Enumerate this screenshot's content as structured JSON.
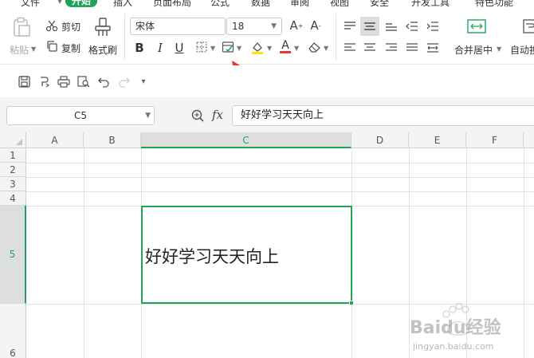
{
  "menu": {
    "items": [
      {
        "label": "文件",
        "x": 30
      },
      {
        "label": "开始",
        "active": true
      },
      {
        "label": "插入"
      },
      {
        "label": "页面布局"
      },
      {
        "label": "公式"
      },
      {
        "label": "数据"
      },
      {
        "label": "审阅"
      },
      {
        "label": "视图"
      },
      {
        "label": "安全"
      },
      {
        "label": "开发工具"
      },
      {
        "label": "特色功能"
      }
    ]
  },
  "ribbon": {
    "paste_label": "粘贴",
    "cut_label": "剪切",
    "copy_label": "复制",
    "format_painter_label": "格式刷",
    "font_name": "宋体",
    "font_size": "18",
    "bold": "B",
    "italic": "I",
    "underline": "U",
    "merge_center_label": "合并居中",
    "auto_wrap_label": "自动换"
  },
  "formula_bar": {
    "name_box": "C5",
    "fx": "fx",
    "value": "好好学习天天向上"
  },
  "grid": {
    "columns": [
      "A",
      "B",
      "C",
      "D",
      "E",
      "F"
    ],
    "active_column": "C",
    "rows": [
      "1",
      "2",
      "3",
      "4",
      "5",
      "6"
    ],
    "active_row": "5",
    "active_cell_ref": "C5",
    "active_cell_value": "好好学习天天向上"
  },
  "watermark": {
    "text": "Baidu经验",
    "sub": "jingyan.baidu.com"
  },
  "colors": {
    "accent": "#1fa45a",
    "arrow": "#e53935",
    "header_bg": "#f3f4f5"
  }
}
